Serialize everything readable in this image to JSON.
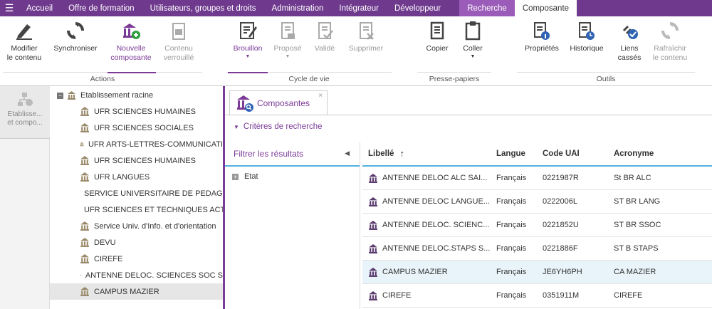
{
  "topbar": {
    "menu": [
      "Accueil",
      "Offre de formation",
      "Utilisateurs, groupes et droits",
      "Administration",
      "Intégrateur",
      "Développeur"
    ],
    "context_tabs": [
      "Recherche",
      "Composante"
    ]
  },
  "ribbon": {
    "actions": {
      "modifier": [
        "Modifier",
        "le contenu"
      ],
      "synchroniser": "Synchroniser",
      "nouvelle": [
        "Nouvelle",
        "composante"
      ],
      "contenu": [
        "Contenu",
        "verrouillé"
      ],
      "group_label": "Actions"
    },
    "cycle": {
      "brouillon": "Brouillon",
      "propose": "Proposé",
      "valide": "Validé",
      "supprimer": "Supprimer",
      "group_label": "Cycle de vie"
    },
    "presse": {
      "copier": "Copier",
      "coller": "Coller",
      "group_label": "Presse-papiers"
    },
    "outils": {
      "proprietes": "Propriétés",
      "historique": "Historique",
      "liens": [
        "Liens",
        "cassés"
      ],
      "rafraichir": [
        "Rafraîchir",
        "le contenu"
      ],
      "group_label": "Outils"
    }
  },
  "leftcol": {
    "label": [
      "Etablisse...",
      "et compo..."
    ]
  },
  "tree": {
    "root": "Etablissement racine",
    "items": [
      "UFR SCIENCES HUMAINES",
      "UFR SCIENCES SOCIALES",
      "UFR ARTS-LETTRES-COMMUNICATI",
      "UFR SCIENCES HUMAINES",
      "UFR LANGUES",
      "SERVICE UNIVERSITAIRE DE PEDAGO",
      "UFR SCIENCES ET TECHNIQUES ACT",
      "Service Univ. d'Info. et d'orientation",
      "DEVU",
      "CIREFE",
      "ANTENNE DELOC. SCIENCES SOC S",
      "CAMPUS MAZIER"
    ]
  },
  "tab": {
    "label": "Composantes",
    "close": "×"
  },
  "criteria": "Critères de recherche",
  "filter": {
    "title": "Filtrer les résultats",
    "item": "Etat"
  },
  "grid": {
    "headers": [
      "Libellé",
      "Langue",
      "Code UAI",
      "Acronyme"
    ],
    "sort_arrow": "↑",
    "rows": [
      [
        "ANTENNE DELOC ALC SAI...",
        "Français",
        "0221987R",
        "St BR ALC"
      ],
      [
        "ANTENNE DELOC LANGUE...",
        "Français",
        "0222006L",
        "ST BR LANG"
      ],
      [
        "ANTENNE DELOC. SCIENC...",
        "Français",
        "0221852U",
        "ST BR SSOC"
      ],
      [
        "ANTENNE DELOC.STAPS S...",
        "Français",
        "0221886F",
        "ST B STAPS"
      ],
      [
        "CAMPUS MAZIER",
        "Français",
        "JE6YH6PH",
        "CA MAZIER"
      ],
      [
        "CIREFE",
        "Français",
        "0351911M",
        "CIREFE"
      ]
    ],
    "selected_row": 4
  },
  "colors": {
    "accent": "#7b3b96",
    "topbar": "#6f3a8e",
    "highlight": "#55b0e0"
  }
}
